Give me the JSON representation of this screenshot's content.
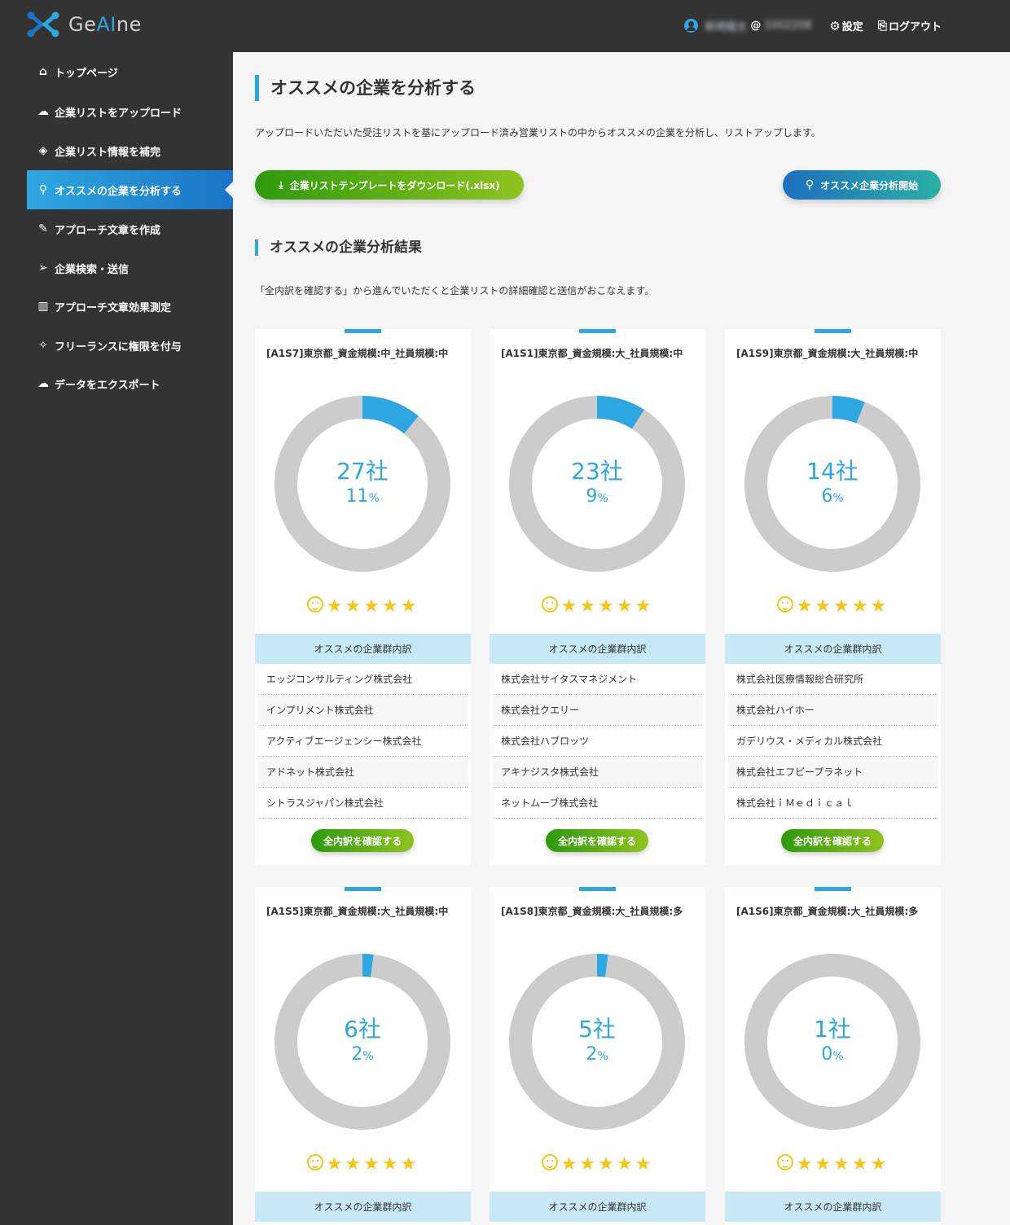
{
  "app": {
    "logo_text_a": "Ge",
    "logo_text_b": "AI",
    "logo_text_c": "ne"
  },
  "header": {
    "user_name": "新崎龍太",
    "user_sep": "@",
    "user_id": "1002208",
    "settings": "設定",
    "logout": "ログアウト"
  },
  "sidebar": {
    "items": [
      {
        "label": "トップページ",
        "icon": "home-icon",
        "glyph": "⌂"
      },
      {
        "label": "企業リストをアップロード",
        "icon": "cloud-upload-icon",
        "glyph": "☁"
      },
      {
        "label": "企業リスト情報を補完",
        "icon": "layers-icon",
        "glyph": "◈"
      },
      {
        "label": "オススメの企業を分析する",
        "icon": "search-icon",
        "glyph": "⚲",
        "active": true
      },
      {
        "label": "アプローチ文章を作成",
        "icon": "pencil-icon",
        "glyph": "✎"
      },
      {
        "label": "企業検索・送信",
        "icon": "paper-plane-icon",
        "glyph": "➢"
      },
      {
        "label": "アプローチ文章効果測定",
        "icon": "bar-chart-icon",
        "glyph": "▥"
      },
      {
        "label": "フリーランスに権限を付与",
        "icon": "magic-wand-icon",
        "glyph": "✧"
      },
      {
        "label": "データをエクスポート",
        "icon": "cloud-export-icon",
        "glyph": "☁"
      }
    ]
  },
  "main": {
    "title": "オススメの企業を分析する",
    "description": "アップロードいただいた受注リストを基にアップロード済み営業リストの中からオススメの企業を分析し、リストアップします。",
    "download_button": "企業リストテンプレートをダウンロード(.xlsx)",
    "analyze_button": "オススメ企業分析開始",
    "results_title": "オススメの企業分析結果",
    "results_description": "「全内訳を確認する」から進んでいただくと企業リストの詳細確認と送信がおこなえます。",
    "list_header": "オススメの企業群内訳",
    "detail_button": "全内訳を確認する",
    "percent_unit": "%",
    "stars": "★★★★★",
    "colors": {
      "accent": "#2ea7e0",
      "ring": "#cccccc",
      "green": "#5bb216",
      "star": "#f5c518"
    }
  },
  "cards": [
    {
      "title": "[A1S7]東京都_資金規模:中_社員規模:中",
      "count": "27社",
      "percent": 11,
      "companies": [
        "エッジコンサルティング株式会社",
        "インプリメント株式会社",
        "アクティブエージェンシー株式会社",
        "アドネット株式会社",
        "シトラスジャパン株式会社"
      ]
    },
    {
      "title": "[A1S1]東京都_資金規模:大_社員規模:中",
      "count": "23社",
      "percent": 9,
      "companies": [
        "株式会社サイタスマネジメント",
        "株式会社クエリー",
        "株式会社ハブロッツ",
        "アキナジスタ株式会社",
        "ネットムーブ株式会社"
      ]
    },
    {
      "title": "[A1S9]東京都_資金規模:大_社員規模:中",
      "count": "14社",
      "percent": 6,
      "companies": [
        "株式会社医療情報総合研究所",
        "株式会社ハイホー",
        "ガデリウス・メディカル株式会社",
        "株式会社エフビープラネット",
        "株式会社ｉＭｅｄｉｃａｌ"
      ]
    },
    {
      "title": "[A1S5]東京都_資金規模:大_社員規模:中",
      "count": "6社",
      "percent": 2,
      "companies": []
    },
    {
      "title": "[A1S8]東京都_資金規模:大_社員規模:多",
      "count": "5社",
      "percent": 2,
      "companies": []
    },
    {
      "title": "[A1S6]東京都_資金規模:大_社員規模:多",
      "count": "1社",
      "percent": 0,
      "companies": []
    }
  ]
}
